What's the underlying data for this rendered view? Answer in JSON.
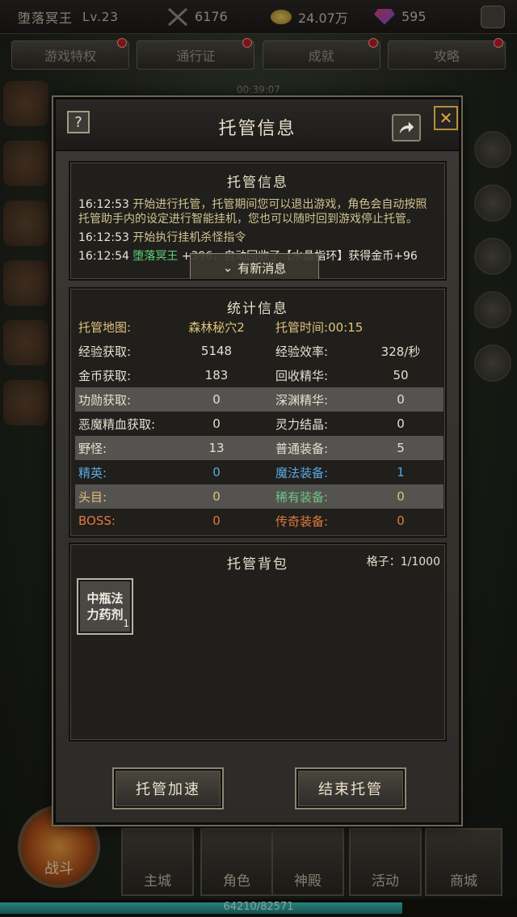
{
  "hud": {
    "player_name": "堕落冥王",
    "level": "Lv.23",
    "power": "6176",
    "gold": "24.07万",
    "gems": "595"
  },
  "tabs": [
    "游戏特权",
    "通行证",
    "成就",
    "攻略"
  ],
  "timer": "00:39:07",
  "bottom_nav": {
    "battle": "战斗",
    "items": [
      "主城",
      "角色",
      "神殿",
      "活动",
      "商城"
    ],
    "exp": "64210/82571",
    "exp_ratio": 0.778
  },
  "dialog": {
    "title": "托管信息",
    "help": "?",
    "close": "✕",
    "log": {
      "title": "托管信息",
      "lines": [
        {
          "ts": "16:12:53",
          "text": "开始进行托管，托管期间您可以退出游戏，角色会自动按照托管助手内的设定进行智能挂机，您也可以随时回到游戏停止托管。"
        },
        {
          "ts": "16:12:53",
          "text": "开始执行挂机杀怪指令"
        },
        {
          "ts": "16:12:54",
          "name": "堕落冥王",
          "text": "+396，自动回收了【水晶指环】获得金币+96"
        }
      ],
      "toast": "有新消息"
    },
    "stats": {
      "title": "统计信息",
      "map_label": "托管地图:",
      "map_value": "森林秘穴2",
      "time_label": "托管时间:",
      "time_value": "00:15",
      "rows": [
        {
          "l1": "经验获取:",
          "v1": "5148",
          "l2": "经验效率:",
          "v2": "328/秒"
        },
        {
          "l1": "金币获取:",
          "v1": "183",
          "l2": "回收精华:",
          "v2": "50"
        },
        {
          "l1": "功勋获取:",
          "v1": "0",
          "l2": "深渊精华:",
          "v2": "0"
        },
        {
          "l1": "恶魔精血获取:",
          "v1": "0",
          "l2": "灵力结晶:",
          "v2": "0"
        },
        {
          "l1": "野怪:",
          "v1": "13",
          "l2": "普通装备:",
          "v2": "5"
        },
        {
          "l1": "精英:",
          "v1": "0",
          "l2": "魔法装备:",
          "v2": "1"
        },
        {
          "l1": "头目:",
          "v1": "0",
          "l2": "稀有装备:",
          "v2": "0"
        },
        {
          "l1": "BOSS:",
          "v1": "0",
          "l2": "传奇装备:",
          "v2": "0"
        }
      ]
    },
    "bag": {
      "title": "托管背包",
      "capacity": "格子：1/1000",
      "item_name": "中瓶法力药剂",
      "item_qty": "1"
    },
    "buttons": {
      "speedup": "托管加速",
      "stop": "结束托管"
    }
  }
}
